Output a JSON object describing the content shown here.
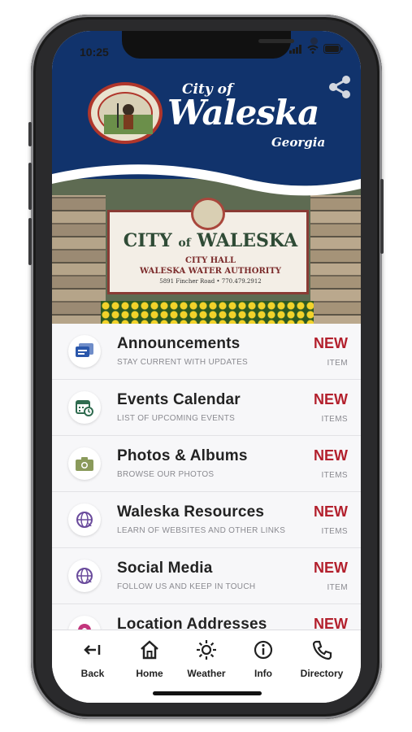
{
  "status_bar": {
    "time": "10:25"
  },
  "header": {
    "brand_city": "City of",
    "brand_name": "Waleska",
    "brand_state": "Georgia",
    "seal_icon": "city-seal-icon",
    "share_icon": "share-icon",
    "background_color": "#11336c"
  },
  "hero_sign": {
    "title_city": "CITY",
    "title_of": "of",
    "title_name": "WALESKA",
    "line2": "CITY HALL",
    "line3": "WALESKA WATER AUTHORITY",
    "line4": "5891 Fincher Road  •  770.479.2912"
  },
  "menu": {
    "new_color": "#b3202d",
    "items": [
      {
        "title": "Announcements",
        "subtitle": "STAY CURRENT WITH UPDATES",
        "badge": "NEW",
        "unit": "ITEM",
        "icon": "chat-bubbles-icon"
      },
      {
        "title": "Events Calendar",
        "subtitle": "LIST OF UPCOMING EVENTS",
        "badge": "NEW",
        "unit": "ITEMS",
        "icon": "calendar-icon"
      },
      {
        "title": "Photos & Albums",
        "subtitle": "BROWSE OUR PHOTOS",
        "badge": "NEW",
        "unit": "ITEMS",
        "icon": "camera-icon"
      },
      {
        "title": "Waleska Resources",
        "subtitle": "LEARN OF WEBSITES AND OTHER LINKS",
        "badge": "NEW",
        "unit": "ITEMS",
        "icon": "globe-icon"
      },
      {
        "title": "Social Media",
        "subtitle": "FOLLOW US AND KEEP IN TOUCH",
        "badge": "NEW",
        "unit": "ITEM",
        "icon": "globe-icon"
      },
      {
        "title": "Location Addresses",
        "subtitle": "",
        "badge": "NEW",
        "unit": "",
        "icon": "map-pin-icon"
      }
    ]
  },
  "tabbar": {
    "items": [
      {
        "label": "Back",
        "icon": "back-arrow-icon"
      },
      {
        "label": "Home",
        "icon": "home-icon"
      },
      {
        "label": "Weather",
        "icon": "sun-icon"
      },
      {
        "label": "Info",
        "icon": "info-icon"
      },
      {
        "label": "Directory",
        "icon": "phone-icon"
      }
    ]
  }
}
